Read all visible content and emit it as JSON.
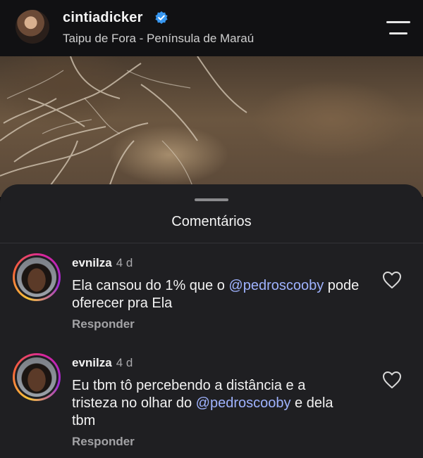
{
  "header": {
    "username": "cintiadicker",
    "location": "Taipu de Fora - Península de Maraú"
  },
  "sheet": {
    "title": "Comentários"
  },
  "comments": [
    {
      "user": "evnilza",
      "time": "4 d",
      "text_before": "Ela cansou do 1% que o ",
      "mention": "@pedroscooby",
      "text_after": " pode oferecer pra Ela",
      "reply_label": "Responder"
    },
    {
      "user": "evnilza",
      "time": "4 d",
      "text_before": "Eu tbm tô percebendo a distância e a tristeza no olhar do ",
      "mention": "@pedroscooby",
      "text_after": " e dela tbm",
      "reply_label": "Responder"
    }
  ],
  "colors": {
    "accent_mention": "#9fb3ff",
    "verified_badge": "#3897f0",
    "sheet_bg": "#1f1f22"
  },
  "icons": [
    "verified-badge-icon",
    "menu-icon",
    "heart-icon"
  ]
}
